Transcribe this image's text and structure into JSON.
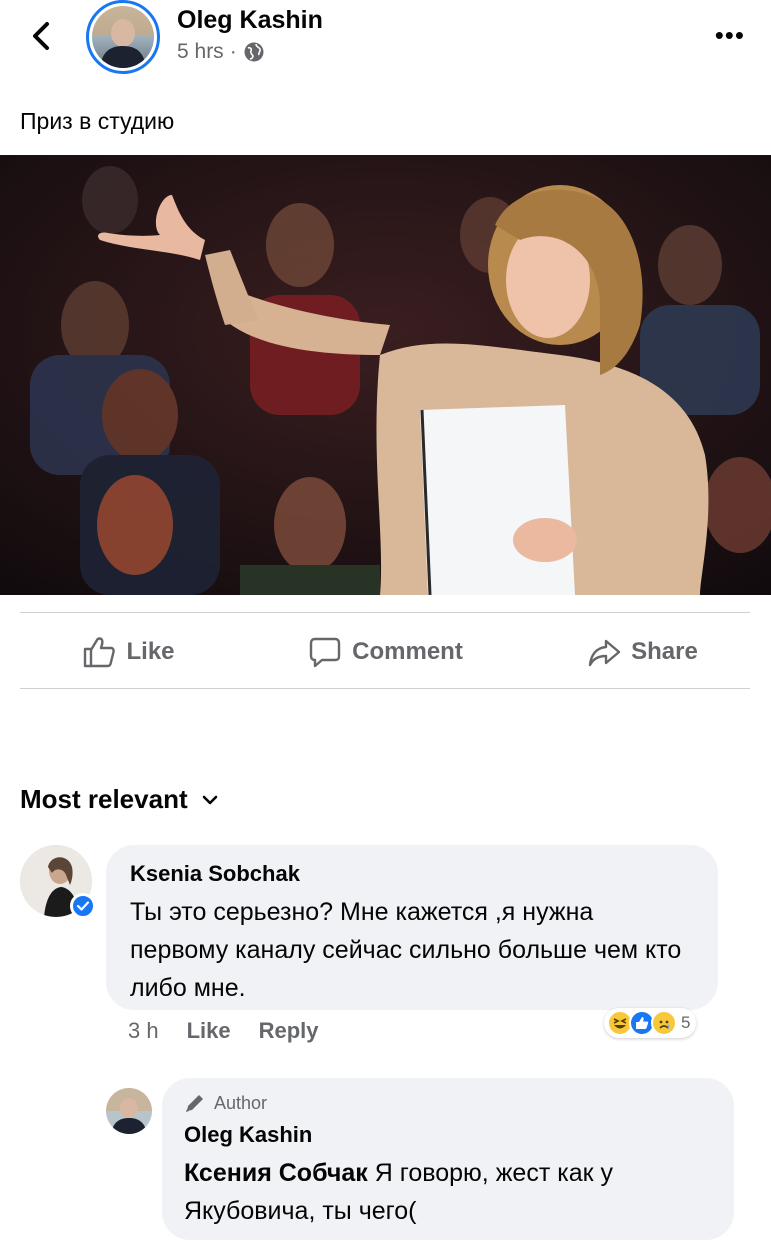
{
  "post": {
    "author": "Oleg Kashin",
    "time": "5 hrs",
    "time_separator": "·",
    "text": "Приз в студию"
  },
  "actions": {
    "like": "Like",
    "comment": "Comment",
    "share": "Share"
  },
  "comments_sort": {
    "label": "Most relevant"
  },
  "comments": [
    {
      "name": "Ksenia Sobchak",
      "text": "Ты это серьезно? Мне кажется ,я нужна первому каналу сейчас сильно больше чем кто либо мне.",
      "time": "3 h",
      "like": "Like",
      "reply": "Reply",
      "reaction_count": "5",
      "reactions": [
        "haha-icon",
        "like-icon",
        "sad-icon"
      ]
    }
  ],
  "reply": {
    "badge": "Author",
    "name": "Oleg Kashin",
    "mention": "Ксения Собчак",
    "text": " Я говорю, жест как у Якубовича, ты чего("
  },
  "colors": {
    "accent": "#1877f2",
    "secondary_text": "#65676b",
    "bubble": "#f0f2f5"
  }
}
